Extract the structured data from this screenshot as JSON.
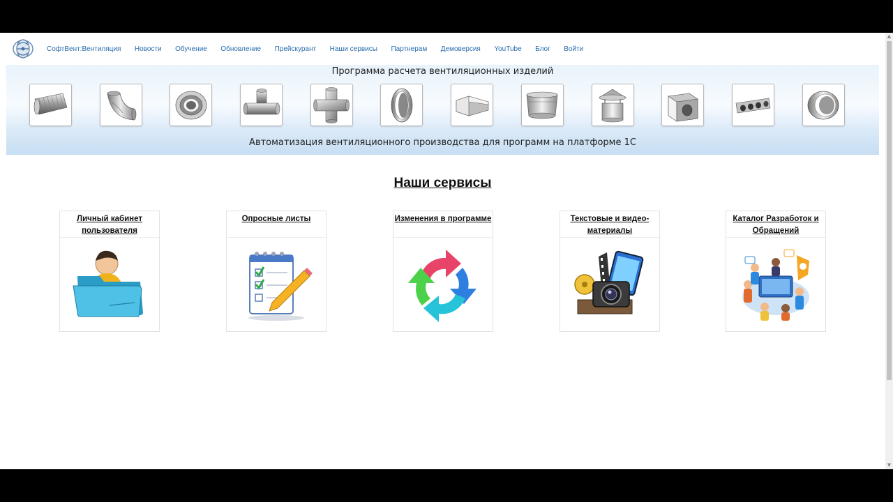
{
  "nav": {
    "brand": "СофтВент:Вентиляция",
    "items": [
      {
        "label": "Новости"
      },
      {
        "label": "Обучение"
      },
      {
        "label": "Обновление"
      },
      {
        "label": "Прейскурант"
      },
      {
        "label": "Наши сервисы"
      },
      {
        "label": "Партнерам"
      },
      {
        "label": "Демоверсия"
      },
      {
        "label": "YouTube"
      },
      {
        "label": "Блог"
      },
      {
        "label": "Войти"
      }
    ],
    "link_color": "#2a6cad"
  },
  "banner": {
    "title": "Программа расчета вентиляционных изделий",
    "subtitle": "Автоматизация вентиляционного производства для программ на платформе 1С",
    "products": [
      {
        "icon": "flexible-duct-icon"
      },
      {
        "icon": "elbow-icon"
      },
      {
        "icon": "reducer-icon"
      },
      {
        "icon": "tee-icon"
      },
      {
        "icon": "cross-icon"
      },
      {
        "icon": "coupling-icon"
      },
      {
        "icon": "rect-transition-icon"
      },
      {
        "icon": "transition-icon"
      },
      {
        "icon": "roof-cap-icon"
      },
      {
        "icon": "plenum-box-icon"
      },
      {
        "icon": "manifold-icon"
      },
      {
        "icon": "collar-icon"
      }
    ]
  },
  "services": {
    "title": "Наши сервисы",
    "cards": [
      {
        "label": "Личный кабинет пользователя",
        "icon": "user-folder-icon"
      },
      {
        "label": "Опросные листы",
        "icon": "checklist-pencil-icon"
      },
      {
        "label": "Изменения в программе",
        "icon": "refresh-cycle-icon"
      },
      {
        "label": "Текстовые и видео-материалы",
        "icon": "media-camera-icon"
      },
      {
        "label": "Каталог Разработок и Обращений",
        "icon": "team-collaboration-icon"
      }
    ]
  }
}
